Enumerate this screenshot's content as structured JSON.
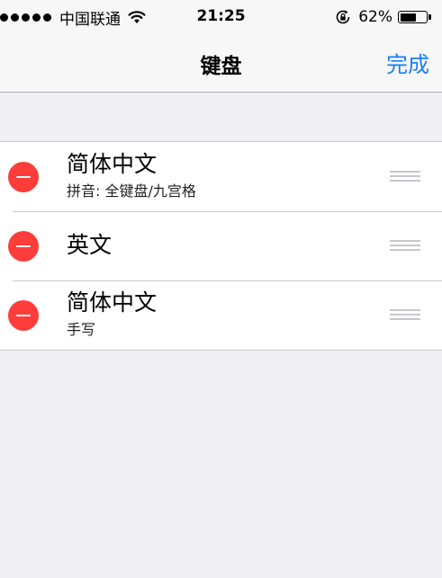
{
  "status_bar": {
    "carrier": "中国联通",
    "time": "21:25",
    "battery_percent": "62%",
    "battery_level": 0.62,
    "icons": [
      "signal-dots-icon",
      "wifi-icon",
      "rotation-lock-icon",
      "battery-icon"
    ]
  },
  "nav": {
    "title": "键盘",
    "done_label": "完成"
  },
  "keyboards": [
    {
      "title": "简体中文",
      "subtitle": "拼音: 全键盘/九宫格"
    },
    {
      "title": "英文",
      "subtitle": ""
    },
    {
      "title": "简体中文",
      "subtitle": "手写"
    }
  ],
  "colors": {
    "accent": "#1a7efb",
    "delete": "#fc3d39",
    "background": "#efeff4",
    "bar": "#f7f7f8"
  }
}
